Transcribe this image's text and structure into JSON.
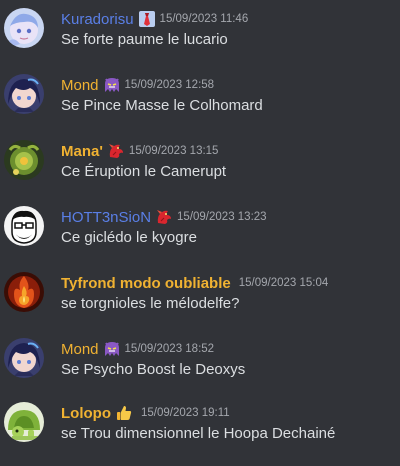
{
  "colors": {
    "background": "#313338",
    "message_text": "#dbdee1",
    "timestamp": "#a4a7ad"
  },
  "messages": [
    {
      "username": "Kuradorisu",
      "name_color": "#5a7fe6",
      "badge_icon": "necktie-icon",
      "timestamp": "15/09/2023 11:46",
      "text": "Se forte paume le lucario",
      "avatar_icon": "anime-avatar-pastel-icon"
    },
    {
      "username": "Mond",
      "name_color": "#f0b232",
      "badge_icon": "purple-ghost-icon",
      "timestamp": "15/09/2023 12:58",
      "text": "Se Pince Masse le Colhomard",
      "avatar_icon": "anime-avatar-dark-hair-icon"
    },
    {
      "username": "Mana'",
      "name_color": "#f0b232",
      "badge_icon": "red-dragon-icon",
      "timestamp": "15/09/2023 13:15",
      "text": "Ce Éruption le Camerupt",
      "avatar_icon": "green-creature-avatar-icon"
    },
    {
      "username": "HOTT3nSioN",
      "name_color": "#5a7fe6",
      "badge_icon": "red-dragon-icon",
      "timestamp": "15/09/2023 13:23",
      "text": "Ce giclédo le kyogre",
      "avatar_icon": "bearded-face-avatar-icon"
    },
    {
      "username": "Tyfrond modo oubliable",
      "name_color": "#f0b232",
      "badge_icon": "",
      "timestamp": "15/09/2023 15:04",
      "text": "se torgnioles le mélodelfe?",
      "avatar_icon": "fire-avatar-icon"
    },
    {
      "username": "Mond",
      "name_color": "#f0b232",
      "badge_icon": "purple-ghost-icon",
      "timestamp": "15/09/2023 18:52",
      "text": "Se Psycho Boost le Deoxys",
      "avatar_icon": "anime-avatar-dark-hair-icon"
    },
    {
      "username": "Lolopo",
      "name_color": "#f0b232",
      "badge_icon": "thumbs-up-icon",
      "timestamp": "15/09/2023 19:11",
      "text": "se Trou dimensionnel le Hoopa Dechainé",
      "avatar_icon": "green-turtle-avatar-icon"
    }
  ]
}
